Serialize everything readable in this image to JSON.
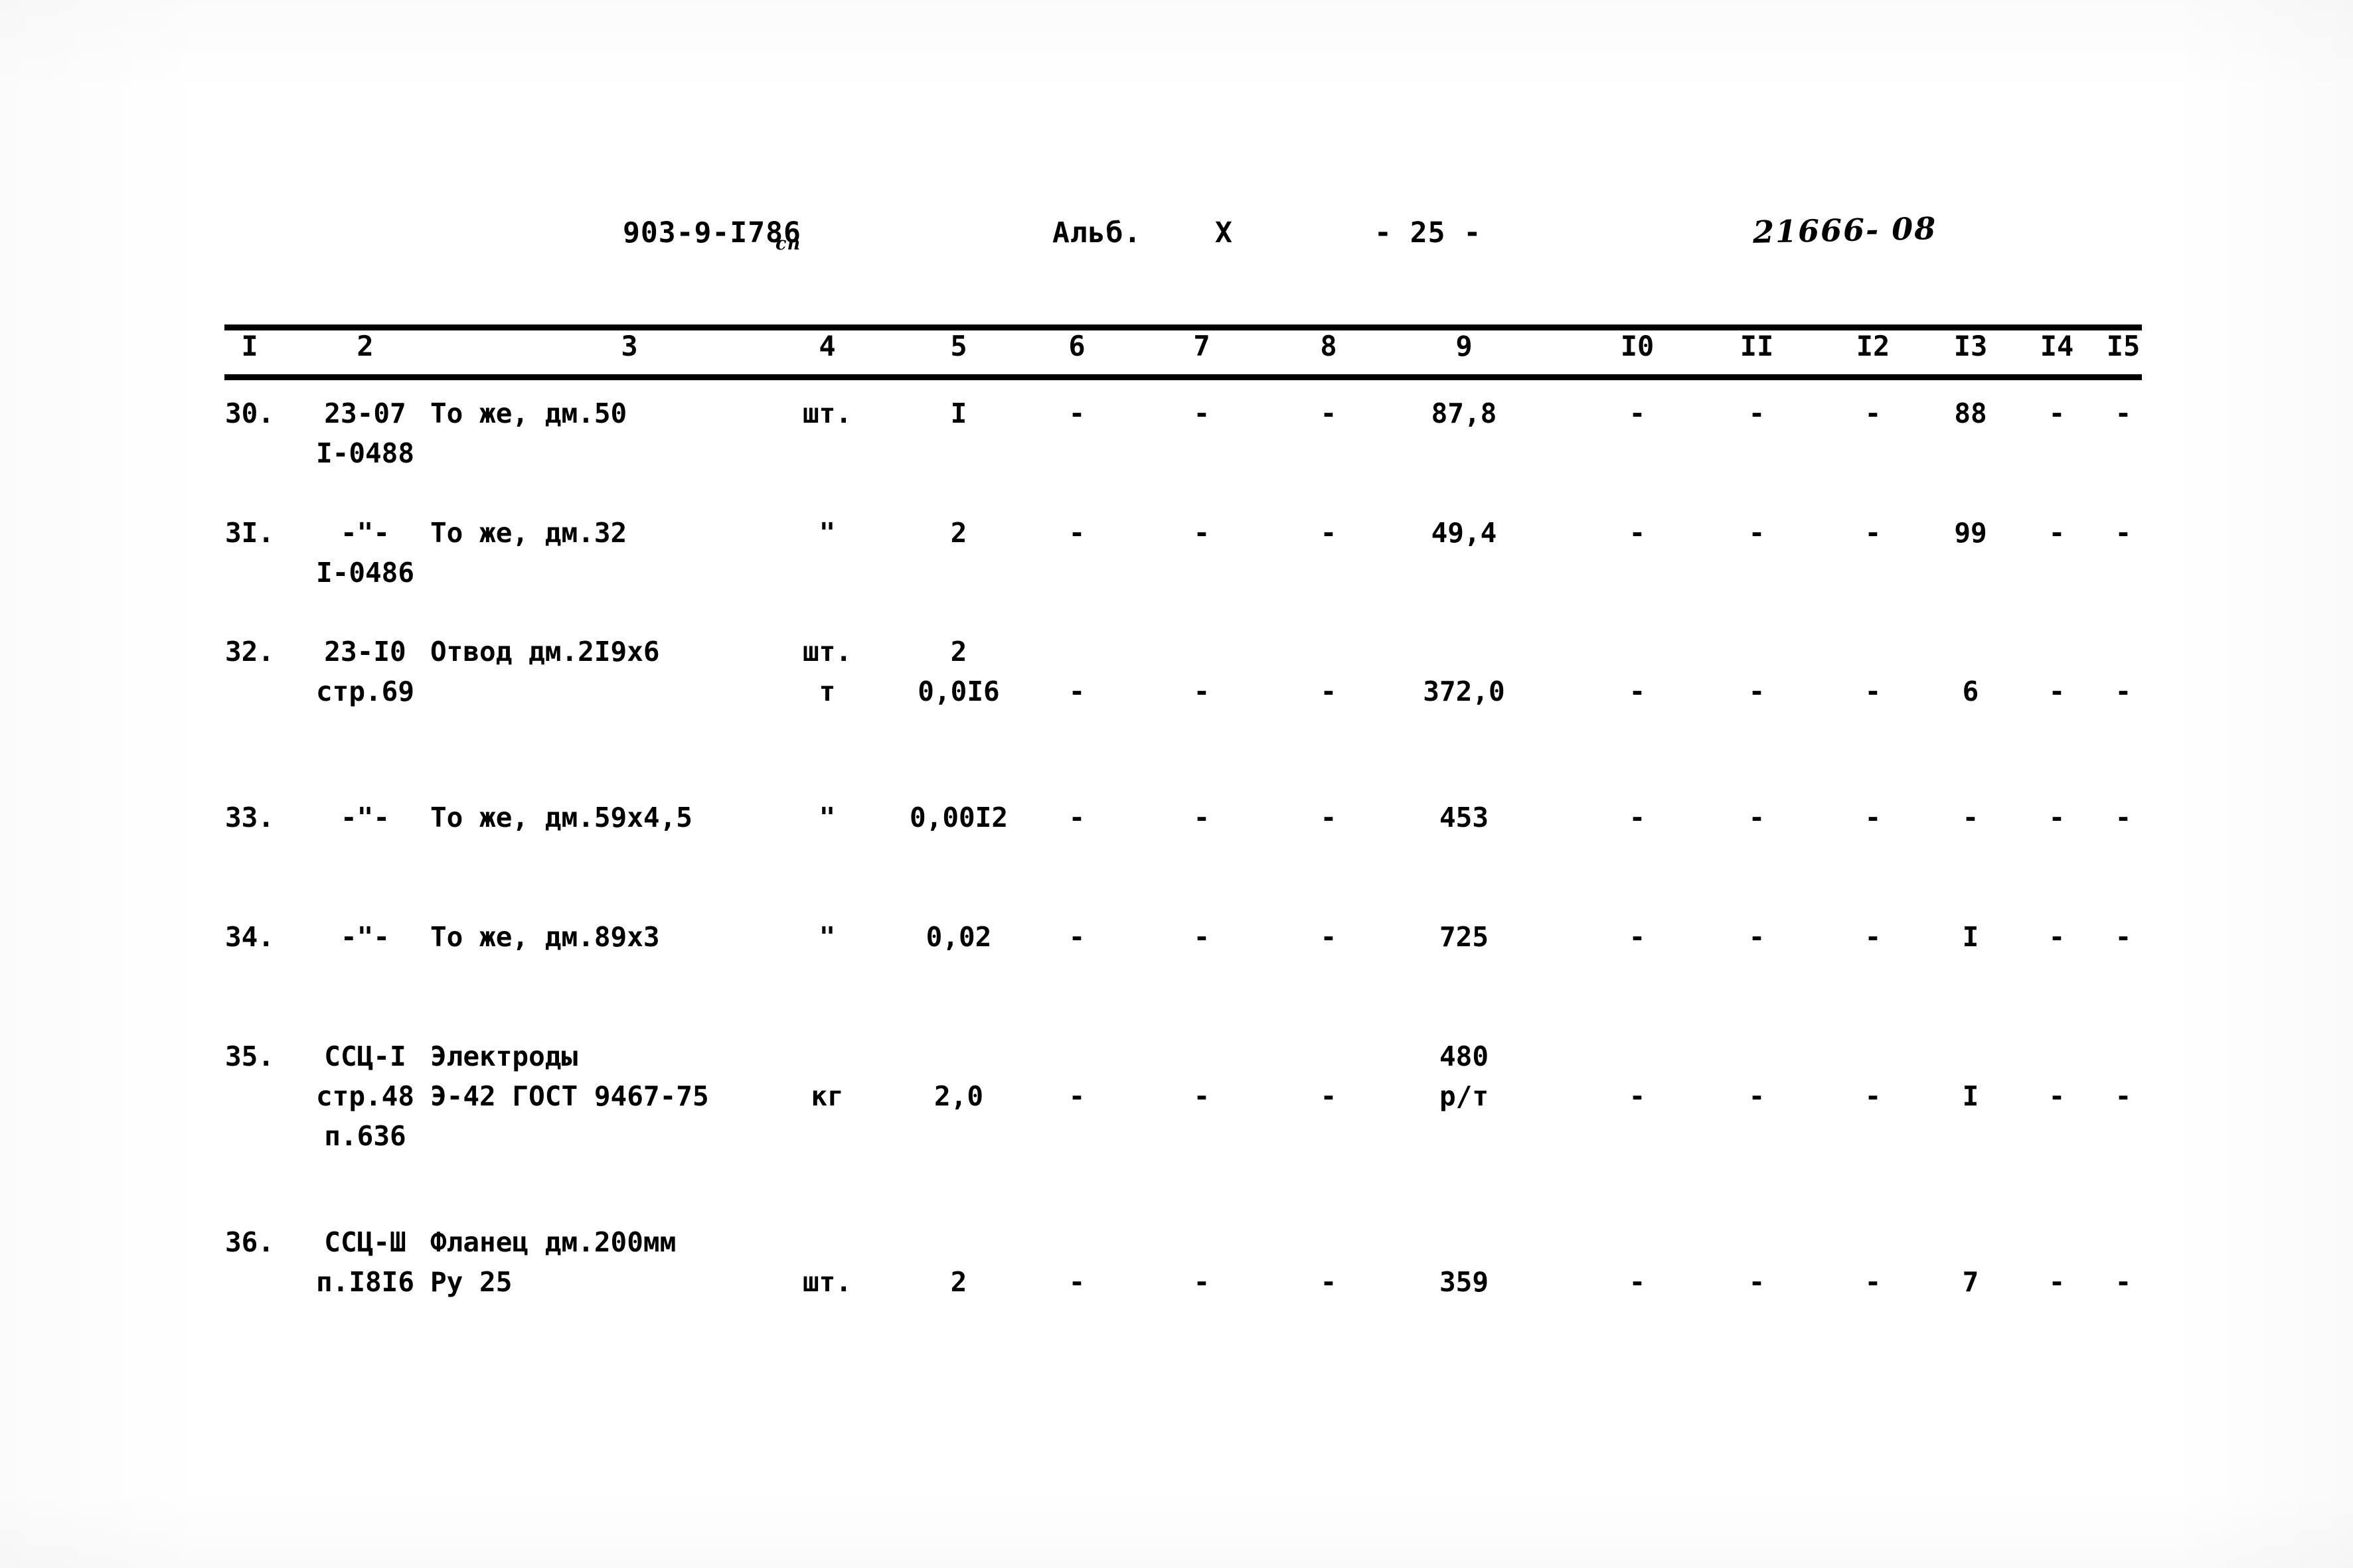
{
  "header": {
    "doc_code": "903-9-I7",
    "doc_code_suffix": "86",
    "doc_code_sub": "сп",
    "album_label": "Альб.",
    "album_number": "X",
    "page_marker": "- 25 -",
    "stamp": "21666- 08"
  },
  "table": {
    "column_numbers": [
      "I",
      "2",
      "3",
      "4",
      "5",
      "6",
      "7",
      "8",
      "9",
      "I0",
      "II",
      "I2",
      "I3",
      "I4",
      "I5"
    ],
    "rows": [
      {
        "num": "30.",
        "code_line1": "23-07",
        "code_line2": "I-0488",
        "name_line1": "То же, дм.50",
        "name_line2": "",
        "unit_line1": "шт.",
        "unit_line2": "",
        "qty_line1": "I",
        "qty_line2": "",
        "c6": "-",
        "c7": "-",
        "c8": "-",
        "c9_line1": "87,8",
        "c9_line2": "",
        "c10": "-",
        "c11": "-",
        "c12": "-",
        "c13": "88",
        "c14": "-",
        "c15": "-"
      },
      {
        "num": "3I.",
        "code_line1": "-\"-",
        "code_line2": "I-0486",
        "name_line1": "То же, дм.32",
        "name_line2": "",
        "unit_line1": "\"",
        "unit_line2": "",
        "qty_line1": "2",
        "qty_line2": "",
        "c6": "-",
        "c7": "-",
        "c8": "-",
        "c9_line1": "49,4",
        "c9_line2": "",
        "c10": "-",
        "c11": "-",
        "c12": "-",
        "c13": "99",
        "c14": "-",
        "c15": "-"
      },
      {
        "num": "32.",
        "code_line1": "23-I0",
        "code_line2": "стр.69",
        "name_line1": "Отвод дм.2I9х6",
        "name_line2": "",
        "unit_line1": "шт.",
        "unit_line2": "т",
        "qty_line1": "2",
        "qty_line2": "0,0I6",
        "c6": "-",
        "c7": "-",
        "c8": "-",
        "c9_line1": "",
        "c9_line2": "372,0",
        "c10": "-",
        "c11": "-",
        "c12": "-",
        "c13": "6",
        "c14": "-",
        "c15": "-"
      },
      {
        "num": "33.",
        "code_line1": "-\"-",
        "code_line2": "",
        "name_line1": "То же, дм.59х4,5",
        "name_line2": "",
        "unit_line1": "\"",
        "unit_line2": "",
        "qty_line1": "0,00I2",
        "qty_line2": "",
        "c6": "-",
        "c7": "-",
        "c8": "-",
        "c9_line1": "453",
        "c9_line2": "",
        "c10": "-",
        "c11": "-",
        "c12": "-",
        "c13": "-",
        "c14": "-",
        "c15": "-"
      },
      {
        "num": "34.",
        "code_line1": "-\"-",
        "code_line2": "",
        "name_line1": "То же, дм.89х3",
        "name_line2": "",
        "unit_line1": "\"",
        "unit_line2": "",
        "qty_line1": "0,02",
        "qty_line2": "",
        "c6": "-",
        "c7": "-",
        "c8": "-",
        "c9_line1": "725",
        "c9_line2": "",
        "c10": "-",
        "c11": "-",
        "c12": "-",
        "c13": "I",
        "c14": "-",
        "c15": "-"
      },
      {
        "num": "35.",
        "code_line1": "ССЦ-I",
        "code_line2": "стр.48",
        "code_line3": "п.636",
        "name_line1": "Электроды",
        "name_line2": "Э-42 ГОСТ 9467-75",
        "unit_line1": "",
        "unit_line2": "кг",
        "qty_line1": "",
        "qty_line2": "2,0",
        "c6": "-",
        "c7": "-",
        "c8": "-",
        "c9_line1": "480",
        "c9_line2": "р/т",
        "c10": "-",
        "c11": "-",
        "c12": "-",
        "c13": "I",
        "c14": "-",
        "c15": "-"
      },
      {
        "num": "36.",
        "code_line1": "ССЦ-Ш",
        "code_line2": "п.I8I6",
        "name_line1": "Фланец дм.200мм",
        "name_line2": "Ру 25",
        "unit_line1": "",
        "unit_line2": "шт.",
        "qty_line1": "",
        "qty_line2": "2",
        "c6": "-",
        "c7": "-",
        "c8": "-",
        "c9_line1": "",
        "c9_line2": "359",
        "c10": "-",
        "c11": "-",
        "c12": "-",
        "c13": "7",
        "c14": "-",
        "c15": "-"
      }
    ]
  }
}
